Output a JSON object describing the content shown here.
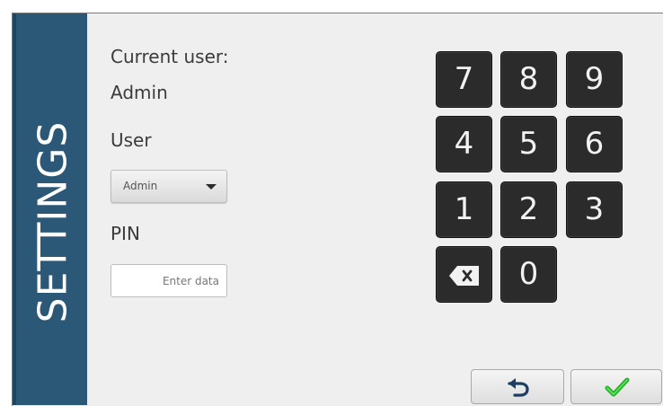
{
  "sidebar": {
    "title": "SETTINGS"
  },
  "current_user": {
    "label": "Current user:",
    "value": "Admin"
  },
  "user": {
    "label": "User",
    "selected": "Admin"
  },
  "pin": {
    "label": "PIN",
    "value": "",
    "placeholder": "Enter data"
  },
  "keypad": {
    "keys": [
      "7",
      "8",
      "9",
      "4",
      "5",
      "6",
      "1",
      "2",
      "3",
      "0"
    ],
    "backspace_icon": "backspace-icon"
  },
  "actions": {
    "back_icon": "undo-arrow-icon",
    "confirm_icon": "checkmark-icon"
  },
  "colors": {
    "sidebar": "#2a5876",
    "key_background": "#2b2b2b",
    "confirm_green": "#22bf23"
  }
}
